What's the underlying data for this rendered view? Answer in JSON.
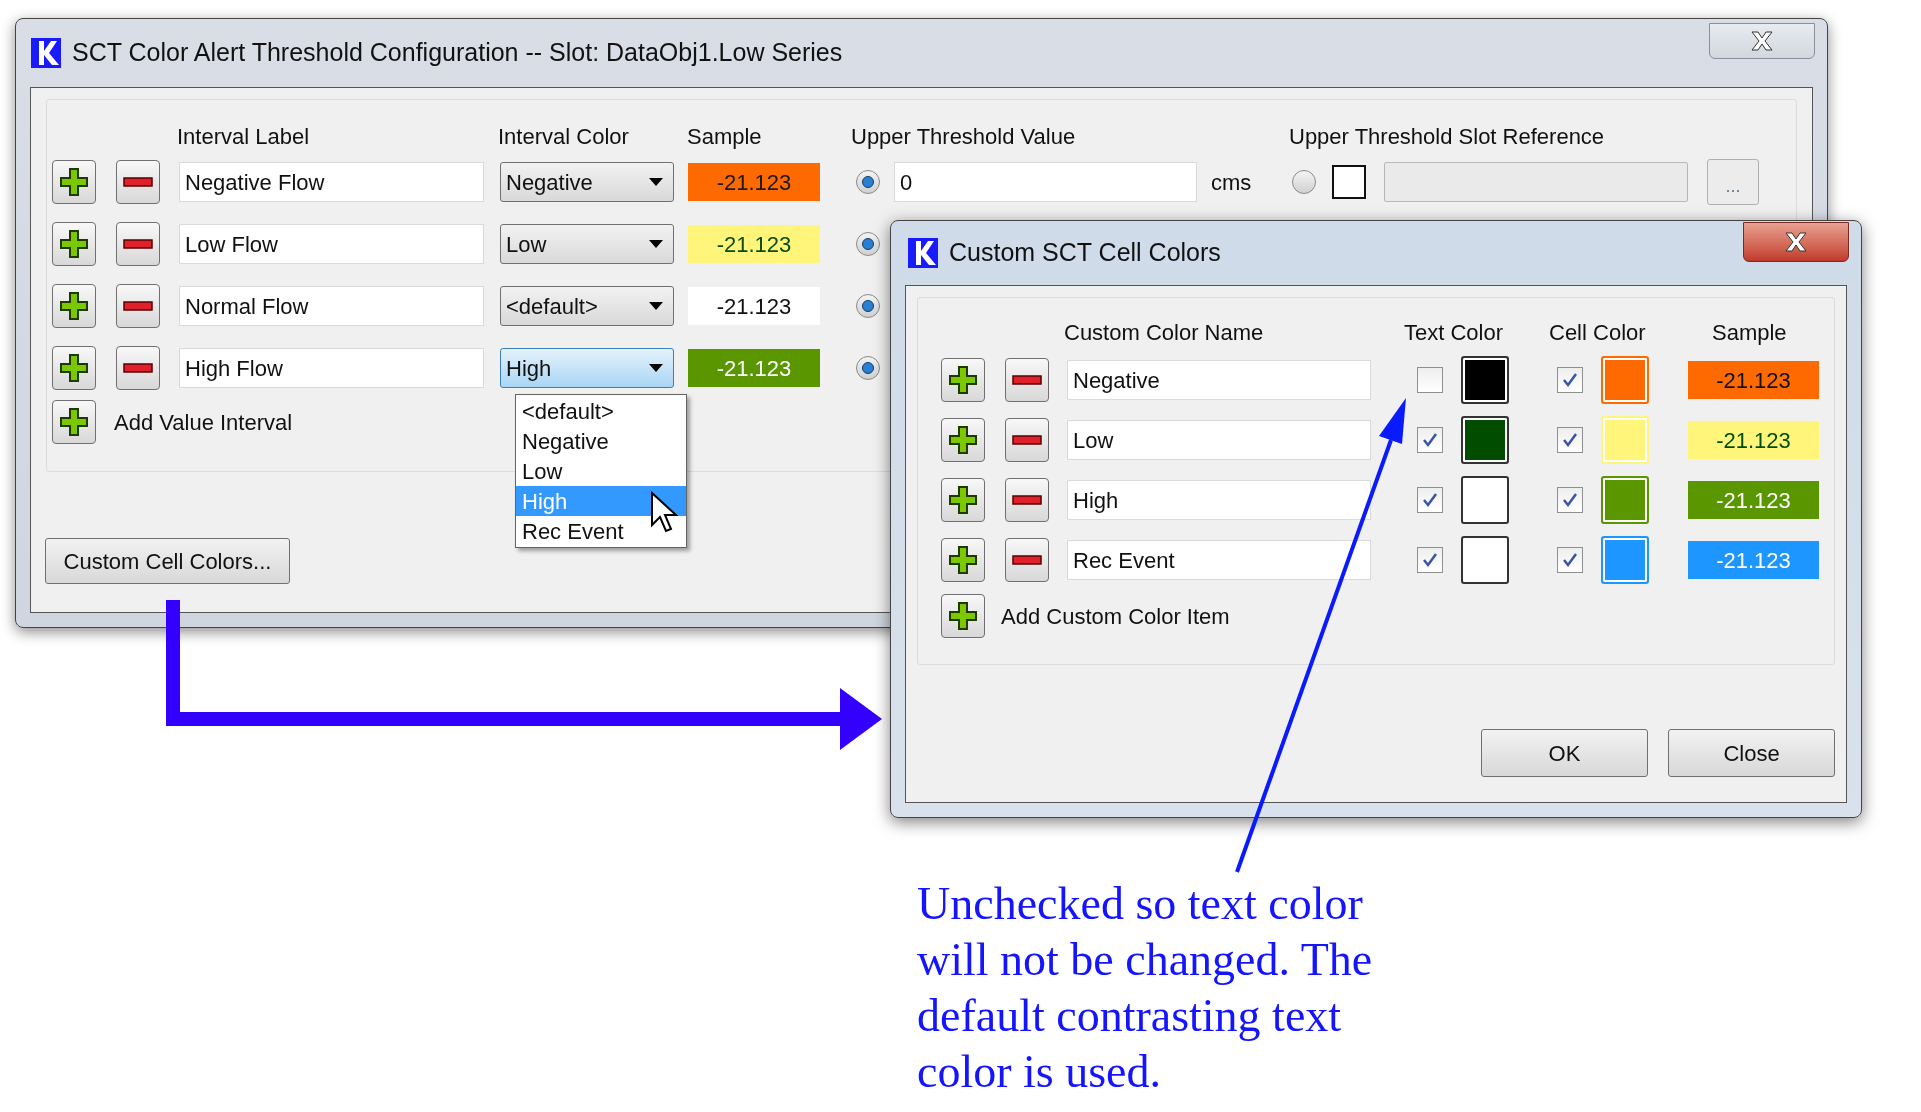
{
  "main_window": {
    "title": "SCT Color Alert Threshold Configuration -- Slot: DataObj1.Low Series",
    "headers": [
      "Interval Label",
      "Interval Color",
      "Sample",
      "Upper Threshold Value",
      "Upper Threshold Slot Reference"
    ],
    "intervals": [
      {
        "label": "Negative Flow",
        "color_name": "Negative",
        "open": false,
        "sample": {
          "text": "-21.123",
          "color": "#ff6a00",
          "ink": {
            "color": "#1a1a1a"
          }
        },
        "radio_selected": true,
        "threshold": {
          "value": "0",
          "unit": "cms",
          "slot_radio_selected": false,
          "slot_checked": false,
          "browse": "..."
        }
      },
      {
        "label": "Low Flow",
        "color_name": "Low",
        "open": false,
        "sample": {
          "text": "-21.123",
          "color": "#fff57a",
          "ink": {
            "color": "#0a4a0a"
          }
        },
        "radio_selected": true
      },
      {
        "label": "Normal Flow",
        "color_name": "<default>",
        "open": false,
        "sample": {
          "text": "-21.123",
          "color": "#ffffff",
          "ink": {
            "color": "#111111"
          }
        },
        "radio_selected": true
      },
      {
        "label": "High Flow",
        "color_name": "High",
        "open": true,
        "sample": {
          "text": "-21.123",
          "color": "#5a9600",
          "ink": {
            "color": "#ffffff"
          }
        },
        "radio_selected": true
      }
    ],
    "add_label": "Add Value Interval",
    "dropdown": [
      {
        "label": "<default>",
        "selected": false
      },
      {
        "label": "Negative",
        "selected": false
      },
      {
        "label": "Low",
        "selected": false
      },
      {
        "label": "High",
        "selected": true
      },
      {
        "label": "Rec Event",
        "selected": false
      }
    ],
    "custom_button": "Custom Cell Colors..."
  },
  "dialog": {
    "title": "Custom SCT Cell Colors",
    "headers": [
      "Custom Color Name",
      "Text Color",
      "Cell Color",
      "Sample"
    ],
    "items": [
      {
        "name": "Negative",
        "text_swatch": {
          "checked": false,
          "color": "#000000"
        },
        "cell_swatch": {
          "checked": true,
          "color": "#ff6a00"
        },
        "sample": "-21.123"
      },
      {
        "name": "Low",
        "text_swatch": {
          "checked": true,
          "color": "#004d00"
        },
        "cell_swatch": {
          "checked": true,
          "color": "#fff57a"
        },
        "sample": "-21.123"
      },
      {
        "name": "High",
        "text_swatch": {
          "checked": true,
          "color": "#ffffff"
        },
        "cell_swatch": {
          "checked": true,
          "color": "#5a9600"
        },
        "sample": "-21.123"
      },
      {
        "name": "Rec Event",
        "text_swatch": {
          "checked": true,
          "color": "#ffffff"
        },
        "cell_swatch": {
          "checked": true,
          "color": "#1e96ff"
        },
        "sample": "-21.123"
      }
    ],
    "add_label": "Add Custom Color Item",
    "buttons": [
      "OK",
      "Close"
    ]
  },
  "annotation": {
    "lines": [
      "Unchecked so text color",
      "will not be changed. The",
      "default contrasting text",
      "color is used."
    ]
  }
}
